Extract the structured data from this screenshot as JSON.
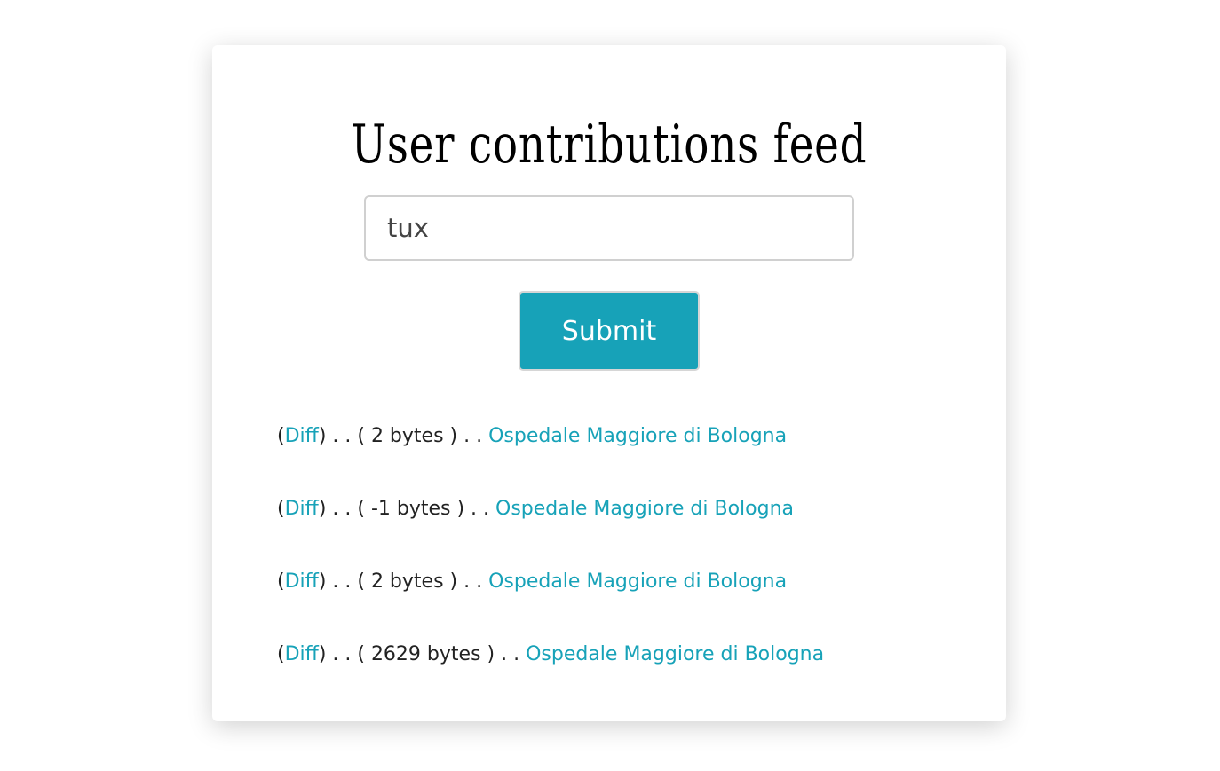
{
  "page": {
    "title": "User contributions feed"
  },
  "search": {
    "value": "tux"
  },
  "submit": {
    "label": "Submit"
  },
  "colors": {
    "accent": "#17a2b8",
    "text": "#222222"
  },
  "feed": {
    "rows": [
      {
        "open_paren": "(",
        "diff_label": "Diff",
        "size_text": ") . . ( 2 bytes ) . . ",
        "page_link": "Ospedale Maggiore di Bologna"
      },
      {
        "open_paren": "(",
        "diff_label": "Diff",
        "size_text": ") . . ( -1 bytes ) . . ",
        "page_link": "Ospedale Maggiore di Bologna"
      },
      {
        "open_paren": "(",
        "diff_label": "Diff",
        "size_text": ") . . ( 2 bytes ) . . ",
        "page_link": "Ospedale Maggiore di Bologna"
      },
      {
        "open_paren": "(",
        "diff_label": "Diff",
        "size_text": ") . . ( 2629 bytes ) . . ",
        "page_link": "Ospedale Maggiore di Bologna"
      }
    ]
  }
}
